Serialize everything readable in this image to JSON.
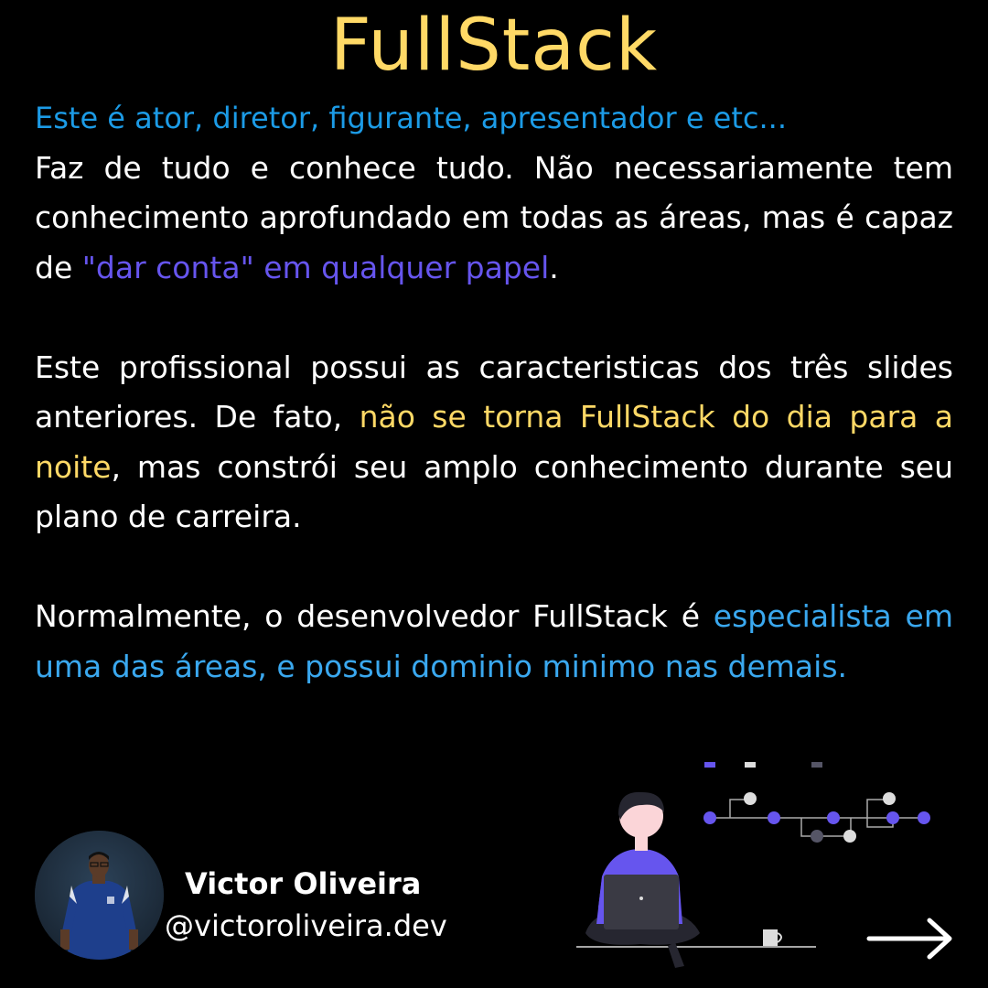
{
  "title": "FullStack",
  "lead": "Este é ator, diretor, figurante, apresentador e etc...",
  "p1": {
    "before": "Faz de tudo e conhece tudo. Não necessariamente tem conhecimento aprofundado em todas as áreas, mas é capaz de ",
    "highlight": "\"dar conta\" em qualquer papel",
    "after": "."
  },
  "p2": {
    "before": "Este profissional possui as caracteristicas dos três slides anteriores. De fato, ",
    "highlight": "não se torna FullStack do dia para a noite",
    "after": ", mas constrói seu amplo conhecimento durante seu plano de carreira."
  },
  "p3": {
    "before": "Normalmente, o desenvolvedor FullStack é ",
    "highlight": "especialista em uma das áreas,  e possui dominio minimo nas demais."
  },
  "author": {
    "name": "Victor Oliveira",
    "handle": "@victoroliveira.dev"
  },
  "icons": {
    "avatar": "profile-photo",
    "illustration": "person-with-laptop-illustration",
    "next": "arrow-right-icon"
  },
  "colors": {
    "background": "#000000",
    "title": "#ffd966",
    "lead": "#1c9be6",
    "purple": "#6655ee",
    "yellow": "#ffd966",
    "blue": "#3aa8ef",
    "text": "#ffffff"
  }
}
